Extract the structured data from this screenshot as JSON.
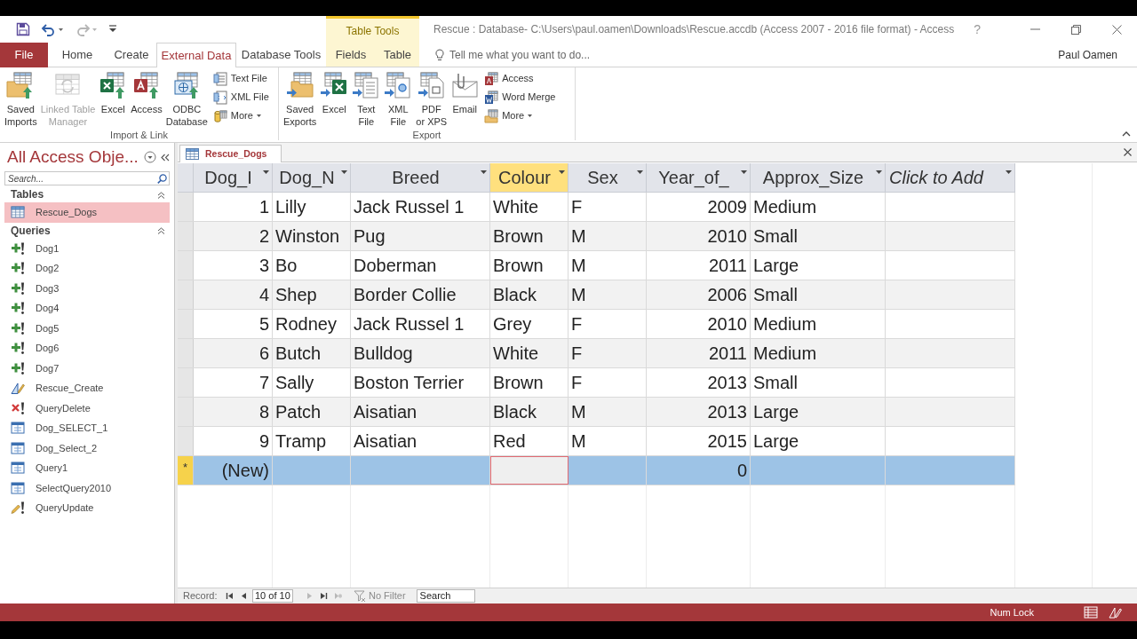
{
  "quick_access": [
    {
      "kind": "save",
      "disabled": false
    },
    {
      "kind": "undo",
      "disabled": false
    },
    {
      "kind": "redo",
      "disabled": true
    },
    {
      "kind": "customize",
      "disabled": false
    }
  ],
  "window": {
    "contextual_group": "Table Tools",
    "title": "Rescue : Database- C:\\Users\\paul.oamen\\Downloads\\Rescue.accdb (Access 2007 - 2016 file format) - Access",
    "help": "?",
    "user": "Paul Oamen"
  },
  "ribbon_tabs": [
    {
      "label": "File",
      "kind": "backstage",
      "selected": false
    },
    {
      "label": "Home",
      "kind": "standard",
      "selected": false
    },
    {
      "label": "Create",
      "kind": "standard",
      "selected": false
    },
    {
      "label": "External Data",
      "kind": "standard",
      "selected": true
    },
    {
      "label": "Database Tools",
      "kind": "standard",
      "selected": false
    },
    {
      "label": "Fields",
      "kind": "contextual",
      "selected": false
    },
    {
      "label": "Table",
      "kind": "contextual",
      "selected": false
    }
  ],
  "tell_me": {
    "placeholder": "Tell me what you want to do..."
  },
  "ribbon_groups": [
    {
      "label": "Import & Link",
      "large": [
        {
          "label": "Saved\nImports",
          "kind": "saved-imports",
          "disabled": false
        },
        {
          "label": "Linked Table\nManager",
          "kind": "linked-table-manager",
          "disabled": true
        },
        {
          "label": "Excel",
          "kind": "excel-import",
          "disabled": false
        },
        {
          "label": "Access",
          "kind": "access-import",
          "disabled": false
        },
        {
          "label": "ODBC\nDatabase",
          "kind": "odbc",
          "disabled": false
        }
      ],
      "small": [
        {
          "label": "Text File",
          "kind": "text-import",
          "menu": false
        },
        {
          "label": "XML File",
          "kind": "xml-import",
          "menu": false
        },
        {
          "label": "More",
          "kind": "more-import",
          "menu": true
        }
      ]
    },
    {
      "label": "Export",
      "large": [
        {
          "label": "Saved\nExports",
          "kind": "saved-exports",
          "disabled": false
        },
        {
          "label": "Excel",
          "kind": "excel-export",
          "disabled": false
        },
        {
          "label": "Text\nFile",
          "kind": "text-export",
          "disabled": false
        },
        {
          "label": "XML\nFile",
          "kind": "xml-export",
          "disabled": false
        },
        {
          "label": "PDF\nor XPS",
          "kind": "pdf-export",
          "disabled": false
        },
        {
          "label": "Email",
          "kind": "email",
          "disabled": false
        }
      ],
      "small": [
        {
          "label": "Access",
          "kind": "access-export",
          "menu": false
        },
        {
          "label": "Word Merge",
          "kind": "word-merge",
          "menu": false
        },
        {
          "label": "More",
          "kind": "more-export",
          "menu": true
        }
      ]
    }
  ],
  "navigation": {
    "title": "All Access Obje...",
    "search": {
      "placeholder": "Search..."
    },
    "groups": [
      {
        "label": "Tables",
        "expanded": true,
        "items": [
          {
            "label": "Rescue_Dogs",
            "kind": "table",
            "selected": true
          }
        ]
      },
      {
        "label": "Queries",
        "expanded": true,
        "items": [
          {
            "label": "Dog1",
            "kind": "append",
            "selected": false
          },
          {
            "label": "Dog2",
            "kind": "append",
            "selected": false
          },
          {
            "label": "Dog3",
            "kind": "append",
            "selected": false
          },
          {
            "label": "Dog4",
            "kind": "append",
            "selected": false
          },
          {
            "label": "Dog5",
            "kind": "append",
            "selected": false
          },
          {
            "label": "Dog6",
            "kind": "append",
            "selected": false
          },
          {
            "label": "Dog7",
            "kind": "append",
            "selected": false
          },
          {
            "label": "Rescue_Create",
            "kind": "make-table",
            "selected": false
          },
          {
            "label": "QueryDelete",
            "kind": "delete",
            "selected": false
          },
          {
            "label": "Dog_SELECT_1",
            "kind": "select",
            "selected": false
          },
          {
            "label": "Dog_Select_2",
            "kind": "select",
            "selected": false
          },
          {
            "label": "Query1",
            "kind": "select",
            "selected": false
          },
          {
            "label": "SelectQuery2010",
            "kind": "select",
            "selected": false
          },
          {
            "label": "QueryUpdate",
            "kind": "update",
            "selected": false
          }
        ]
      }
    ]
  },
  "document_tabs": [
    {
      "label": "Rescue_Dogs",
      "selected": true
    }
  ],
  "datasheet": {
    "columns": [
      {
        "label": "Dog_I",
        "kind": "autonumber",
        "selected": false
      },
      {
        "label": "Dog_N",
        "kind": "text",
        "selected": false
      },
      {
        "label": "Breed",
        "kind": "text",
        "selected": false
      },
      {
        "label": "Colour",
        "kind": "text",
        "selected": true
      },
      {
        "label": "Sex",
        "kind": "text",
        "selected": false
      },
      {
        "label": "Year_of_",
        "kind": "number",
        "selected": false
      },
      {
        "label": "Approx_Size",
        "kind": "text",
        "selected": false
      },
      {
        "label": "Click to Add",
        "kind": "add",
        "selected": false
      }
    ],
    "rows": [
      {
        "cells": [
          "1",
          "Lilly",
          "Jack Russel 1",
          "White",
          "F",
          "2009",
          "Medium"
        ],
        "selected": false
      },
      {
        "cells": [
          "2",
          "Winston",
          "Pug",
          "Brown",
          "M",
          "2010",
          "Small"
        ],
        "selected": false
      },
      {
        "cells": [
          "3",
          "Bo",
          "Doberman",
          "Brown",
          "M",
          "2011",
          "Large"
        ],
        "selected": false
      },
      {
        "cells": [
          "4",
          "Shep",
          "Border Collie",
          "Black",
          "M",
          "2006",
          "Small"
        ],
        "selected": false
      },
      {
        "cells": [
          "5",
          "Rodney",
          "Jack Russel 1",
          "Grey",
          "F",
          "2010",
          "Medium"
        ],
        "selected": false
      },
      {
        "cells": [
          "6",
          "Butch",
          "Bulldog",
          "White",
          "F",
          "2011",
          "Medium"
        ],
        "selected": false
      },
      {
        "cells": [
          "7",
          "Sally",
          "Boston Terrier",
          "Brown",
          "F",
          "2013",
          "Small"
        ],
        "selected": false
      },
      {
        "cells": [
          "8",
          "Patch",
          "Aisatian",
          "Black",
          "M",
          "2013",
          "Large"
        ],
        "selected": false
      },
      {
        "cells": [
          "9",
          "Tramp",
          "Aisatian",
          "Red",
          "M",
          "2015",
          "Large"
        ],
        "selected": false
      }
    ],
    "new_record": {
      "marker": "*",
      "id": "(New)",
      "year": "0",
      "selected": true
    }
  },
  "record_navigator": {
    "label": "Record:",
    "position": "10 of 10",
    "buttons": [
      {
        "kind": "first",
        "disabled": false
      },
      {
        "kind": "previous",
        "disabled": false
      },
      {
        "kind": "next",
        "disabled": true
      },
      {
        "kind": "last",
        "disabled": false
      },
      {
        "kind": "new",
        "disabled": true
      }
    ],
    "filter": {
      "label": "No Filter",
      "active": false
    },
    "search": {
      "placeholder": "Search"
    }
  },
  "status_bar": {
    "indicators": [
      "Num Lock"
    ],
    "views": [
      {
        "kind": "datasheet"
      },
      {
        "kind": "design"
      }
    ]
  }
}
